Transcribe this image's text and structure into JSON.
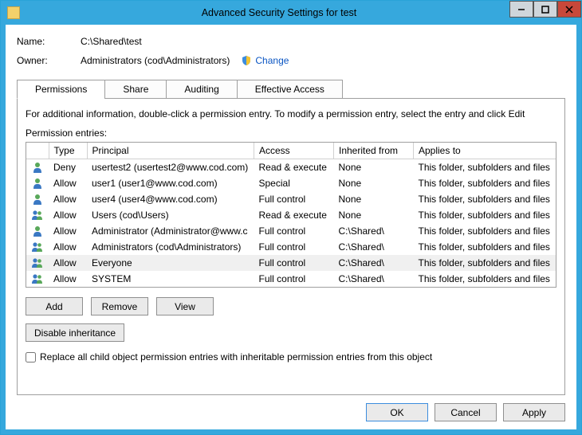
{
  "window": {
    "title": "Advanced Security Settings for test",
    "minimize": "—",
    "maximize": "□",
    "close": "×"
  },
  "meta": {
    "name_label": "Name:",
    "name_value": "C:\\Shared\\test",
    "owner_label": "Owner:",
    "owner_value": "Administrators (cod\\Administrators)",
    "change_link": "Change"
  },
  "tabs": {
    "permissions": "Permissions",
    "share": "Share",
    "auditing": "Auditing",
    "effective": "Effective Access"
  },
  "panel": {
    "info": "For additional information, double-click a permission entry. To modify a permission entry, select the entry and click Edit",
    "entries_label": "Permission entries:"
  },
  "headers": {
    "type": "Type",
    "principal": "Principal",
    "access": "Access",
    "inherited": "Inherited from",
    "applies": "Applies to"
  },
  "rows": [
    {
      "icon": "single",
      "type": "Deny",
      "principal": "usertest2 (usertest2@www.cod.com)",
      "access": "Read & execute",
      "inherited": "None",
      "applies": "This folder, subfolders and files"
    },
    {
      "icon": "single",
      "type": "Allow",
      "principal": "user1 (user1@www.cod.com)",
      "access": "Special",
      "inherited": "None",
      "applies": "This folder, subfolders and files"
    },
    {
      "icon": "single",
      "type": "Allow",
      "principal": "user4 (user4@www.cod.com)",
      "access": "Full control",
      "inherited": "None",
      "applies": "This folder, subfolders and files"
    },
    {
      "icon": "group",
      "type": "Allow",
      "principal": "Users (cod\\Users)",
      "access": "Read & execute",
      "inherited": "None",
      "applies": "This folder, subfolders and files"
    },
    {
      "icon": "single",
      "type": "Allow",
      "principal": "Administrator (Administrator@www.c",
      "access": "Full control",
      "inherited": "C:\\Shared\\",
      "applies": "This folder, subfolders and files"
    },
    {
      "icon": "group",
      "type": "Allow",
      "principal": "Administrators (cod\\Administrators)",
      "access": "Full control",
      "inherited": "C:\\Shared\\",
      "applies": "This folder, subfolders and files"
    },
    {
      "icon": "group",
      "type": "Allow",
      "principal": "Everyone",
      "access": "Full control",
      "inherited": "C:\\Shared\\",
      "applies": "This folder, subfolders and files",
      "selected": true
    },
    {
      "icon": "group",
      "type": "Allow",
      "principal": "SYSTEM",
      "access": "Full control",
      "inherited": "C:\\Shared\\",
      "applies": "This folder, subfolders and files"
    }
  ],
  "buttons": {
    "add": "Add",
    "remove": "Remove",
    "view": "View",
    "disable": "Disable inheritance"
  },
  "checkbox": {
    "replace_label": "Replace all child object permission entries with inheritable permission entries from this object"
  },
  "footer": {
    "ok": "OK",
    "cancel": "Cancel",
    "apply": "Apply"
  }
}
